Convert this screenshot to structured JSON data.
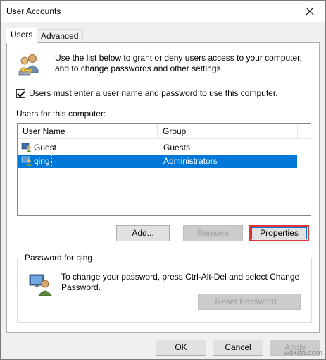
{
  "window": {
    "title": "User Accounts"
  },
  "tabs": [
    {
      "label": "Users",
      "active": true
    },
    {
      "label": "Advanced",
      "active": false
    }
  ],
  "intro": {
    "text": "Use the list below to grant or deny users access to your computer, and to change passwords and other settings."
  },
  "require_login": {
    "label": "Users must enter a user name and password to use this computer.",
    "checked": true
  },
  "users_list": {
    "label": "Users for this computer:",
    "columns": [
      "User Name",
      "Group"
    ],
    "rows": [
      {
        "name": "Guest",
        "group": "Guests",
        "selected": false
      },
      {
        "name": "qing",
        "group": "Administrators",
        "selected": true
      }
    ]
  },
  "list_buttons": {
    "add": "Add...",
    "remove": "Remove",
    "properties": "Properties"
  },
  "password": {
    "group_title": "Password for qing",
    "text": "To change your password, press Ctrl-Alt-Del and select Change Password.",
    "reset_button": "Reset Password..."
  },
  "footer": {
    "ok": "OK",
    "cancel": "Cancel",
    "apply": "Apply"
  },
  "watermark": "wsxdn.com",
  "colors": {
    "selection": "#0078d7",
    "highlight_border": "#d9373b"
  }
}
